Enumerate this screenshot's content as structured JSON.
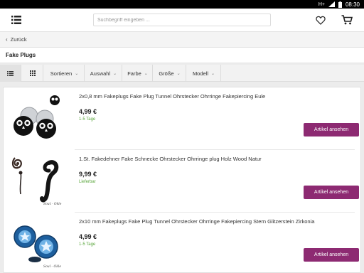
{
  "status_bar": {
    "network": "H+",
    "time": "08:30"
  },
  "header": {
    "search_placeholder": "Suchbegriff eingeben ...",
    "icons": [
      "menu-icon",
      "heart-icon",
      "cart-icon"
    ]
  },
  "back": {
    "label": "Zurück"
  },
  "page": {
    "title": "Fake Plugs"
  },
  "filters": {
    "sort": "Sortieren",
    "auswahl": "Auswahl",
    "farbe": "Farbe",
    "groesse": "Größe",
    "modell": "Modell"
  },
  "products": [
    {
      "title": "2x0,8 mm Fakeplugs Fake Plug Tunnel Ohrstecker Ohrringe Fakepiercing Eule",
      "price": "4,99 €",
      "delivery": "1-5 Tage",
      "button": "Artikel ansehen"
    },
    {
      "title": "1.St. Fakedehner Fake Schnecke Ohrstecker Ohrringe plug Holz Wood Natur",
      "price": "9,99 €",
      "delivery": "Lieferbar",
      "button": "Artikel ansehen",
      "image_brand": "Sout - Okle"
    },
    {
      "title": "2x10 mm Fakeplugs Fake Plug Tunnel Ohrstecker Ohrringe Fakepiercing Stern Glitzerstein Zirkonia",
      "price": "4,99 €",
      "delivery": "1-5 Tage",
      "button": "Artikel ansehen",
      "image_brand": "Soul - Okle"
    }
  ],
  "colors": {
    "accent": "#8d2a72",
    "delivery_green": "#5aa63c"
  }
}
